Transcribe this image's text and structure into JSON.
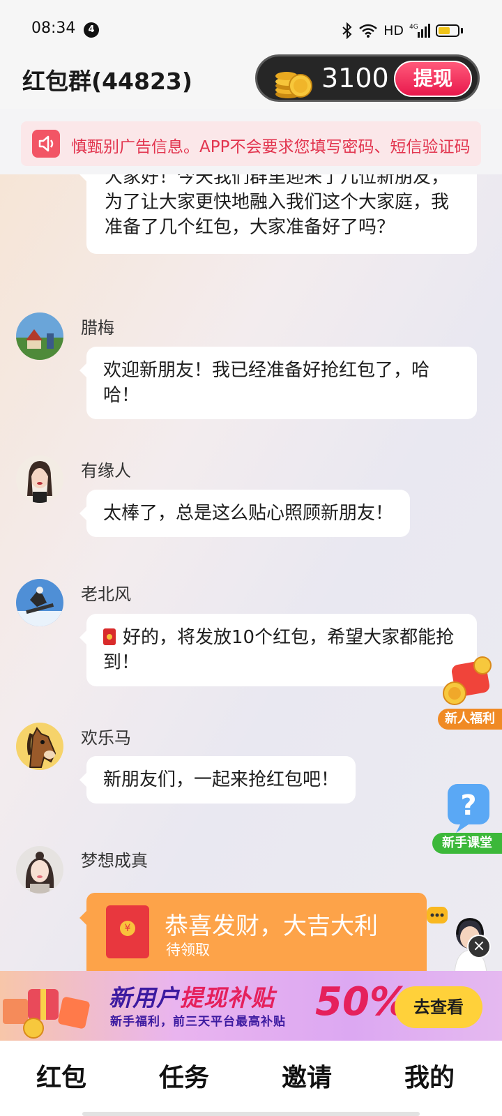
{
  "status_bar": {
    "time": "08:34",
    "notification_count": "4",
    "network": "HD",
    "signal_label": "4G"
  },
  "header": {
    "group_title": "红包群(44823)",
    "coin_count": "3100",
    "withdraw_label": "提现"
  },
  "notice": {
    "text": "慎甄别广告信息。APP不会要求您填写密码、短信验证码"
  },
  "messages": [
    {
      "sender": "",
      "text": "大家好！今天我们群里迎来了几位新朋友，为了让大家更快地融入我们这个大家庭，我准备了几个红包，大家准备好了吗？"
    },
    {
      "sender": "腊梅",
      "text": "欢迎新朋友！我已经准备好抢红包了，哈哈！"
    },
    {
      "sender": "有缘人",
      "text": "太棒了，总是这么贴心照顾新朋友！"
    },
    {
      "sender": "老北风",
      "text": "好的，将发放10个红包，希望大家都能抢到！"
    },
    {
      "sender": "欢乐马",
      "text": "新朋友们，一起来抢红包吧！"
    },
    {
      "sender": "梦想成真",
      "text": ""
    }
  ],
  "red_packet": {
    "title": "恭喜发财，大吉大利",
    "status": "待领取"
  },
  "floats": {
    "welfare_label": "新人福利",
    "class_label": "新手课堂"
  },
  "banner": {
    "title_a": "新用户",
    "title_b": "提现补贴",
    "percent": "50%",
    "subtitle": "新手福利，前三天平台最高补贴",
    "button": "去查看"
  },
  "tabs": [
    "红包",
    "任务",
    "邀请",
    "我的"
  ],
  "colors": {
    "accent_red": "#e8184c",
    "red_packet_orange": "#fda349",
    "notice_red": "#e2344e",
    "banner_purple": "#3c1aa0",
    "welfare_orange": "#f08a24",
    "class_green": "#3cb83a"
  }
}
